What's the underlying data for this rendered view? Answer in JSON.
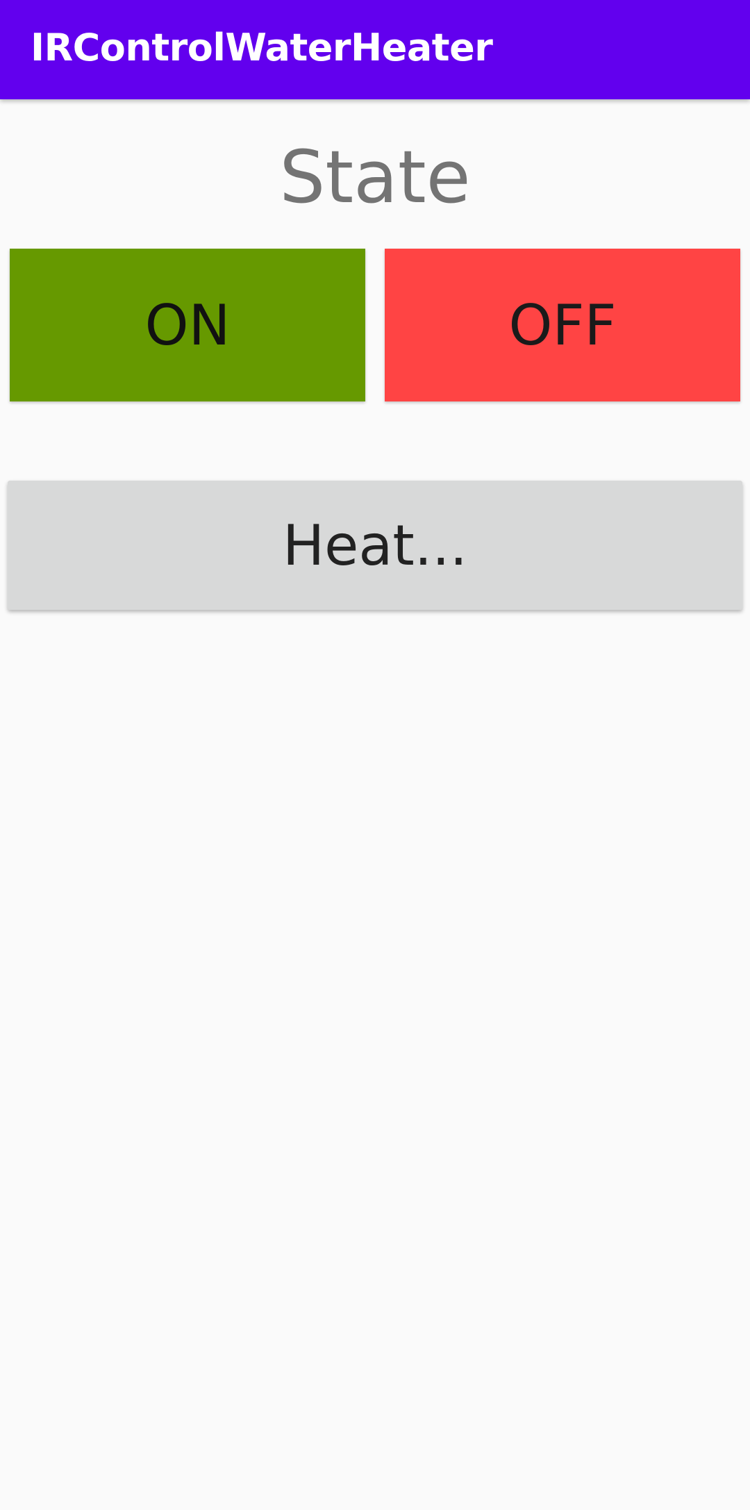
{
  "app_bar": {
    "title": "IRControlWaterHeater",
    "color": "#6200ee"
  },
  "state": {
    "label": "State"
  },
  "buttons": {
    "on": {
      "label": "ON",
      "color": "#669900"
    },
    "off": {
      "label": "OFF",
      "color": "#ff4444"
    },
    "heat": {
      "label": "Heat...",
      "color": "#d8d9d9"
    }
  }
}
